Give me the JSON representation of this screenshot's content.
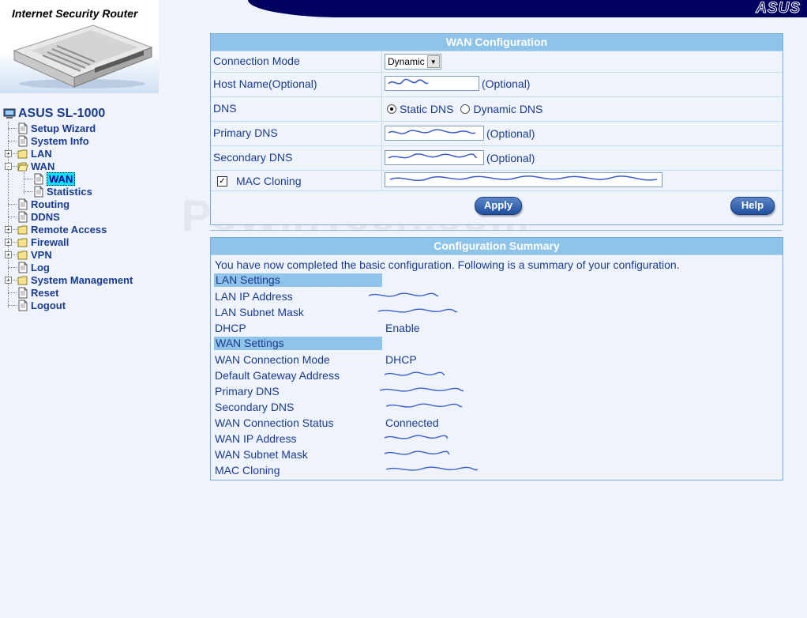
{
  "header": {
    "product_title": "Internet Security Router",
    "brand_logo": "ASUS",
    "brand_color": "#00005e"
  },
  "nav": {
    "root_label": "ASUS SL-1000",
    "items": [
      {
        "label": "Setup Wizard",
        "icon": "page-icon"
      },
      {
        "label": "System Info",
        "icon": "page-icon"
      },
      {
        "label": "LAN",
        "icon": "folder-icon",
        "expander": "+"
      },
      {
        "label": "WAN",
        "icon": "folder-open-icon",
        "expander": "-"
      },
      {
        "label": "WAN",
        "icon": "page-icon",
        "selected": true
      },
      {
        "label": "Statistics",
        "icon": "page-icon"
      },
      {
        "label": "Routing",
        "icon": "page-icon"
      },
      {
        "label": "DDNS",
        "icon": "page-icon"
      },
      {
        "label": "Remote Access",
        "icon": "folder-icon",
        "expander": "+"
      },
      {
        "label": "Firewall",
        "icon": "folder-icon",
        "expander": "+"
      },
      {
        "label": "VPN",
        "icon": "folder-icon",
        "expander": "+"
      },
      {
        "label": "Log",
        "icon": "page-icon"
      },
      {
        "label": "System Management",
        "icon": "folder-icon",
        "expander": "+"
      },
      {
        "label": "Reset",
        "icon": "page-icon"
      },
      {
        "label": "Logout",
        "icon": "page-icon"
      }
    ]
  },
  "watermark": "PcWinTech.com",
  "wan_config": {
    "title": "WAN Configuration",
    "connection_mode": {
      "label": "Connection Mode",
      "value": "Dynamic"
    },
    "host_name": {
      "label": "Host Name(Optional)",
      "hint": "(Optional)"
    },
    "dns": {
      "label": "DNS",
      "option_static": "Static DNS",
      "option_dynamic": "Dynamic DNS",
      "selected": "Static DNS"
    },
    "primary_dns": {
      "label": "Primary DNS",
      "hint": "(Optional)"
    },
    "secondary_dns": {
      "label": "Secondary DNS",
      "hint": "(Optional)"
    },
    "mac_cloning": {
      "label": "MAC Cloning",
      "checked": true
    },
    "apply_label": "Apply",
    "help_label": "Help"
  },
  "summary": {
    "title": "Configuration Summary",
    "intro": "You have now completed the basic configuration. Following is a summary of your configuration.",
    "lan_section": "LAN Settings",
    "lan_ip_label": "LAN IP Address",
    "lan_mask_label": "LAN Subnet Mask",
    "dhcp_label": "DHCP",
    "dhcp_value": "Enable",
    "wan_section": "WAN Settings",
    "wan_mode_label": "WAN Connection Mode",
    "wan_mode_value": "DHCP",
    "gateway_label": "Default Gateway Address",
    "primary_dns_label": "Primary DNS",
    "secondary_dns_label": "Secondary DNS",
    "status_label": "WAN Connection Status",
    "status_value": "Connected",
    "wan_ip_label": "WAN IP Address",
    "wan_mask_label": "WAN Subnet Mask",
    "mac_label": "MAC Cloning"
  }
}
